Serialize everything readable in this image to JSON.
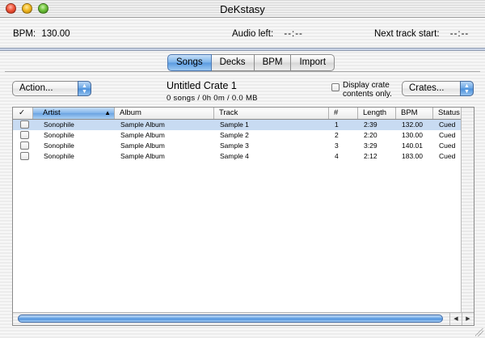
{
  "window": {
    "title": "DeKstasy"
  },
  "status": {
    "bpm_label": "BPM:",
    "bpm_value": "130.00",
    "audio_left_label": "Audio left:",
    "audio_left_value": "--:--",
    "next_track_label": "Next track start:",
    "next_track_value": "--:--"
  },
  "tabs": [
    {
      "label": "Songs",
      "selected": true
    },
    {
      "label": "Decks",
      "selected": false
    },
    {
      "label": "BPM",
      "selected": false
    },
    {
      "label": "Import",
      "selected": false
    }
  ],
  "toolbar": {
    "action_popup": "Action...",
    "crates_popup": "Crates..."
  },
  "crate": {
    "name": "Untitled Crate 1",
    "info": "0 songs / 0h 0m / 0.0 MB",
    "display_checkbox_label": "Display crate contents only.",
    "display_checked": false
  },
  "table": {
    "columns": [
      "✓",
      "Artist",
      "Album",
      "Track",
      "#",
      "Length",
      "BPM",
      "Status"
    ],
    "sorted_column": "Artist",
    "rows": [
      {
        "checked": false,
        "artist": "Sonophile",
        "album": "Sample Album",
        "track": "Sample 1",
        "num": "1",
        "length": "2:39",
        "bpm": "132.00",
        "status": "Cued",
        "selected": true
      },
      {
        "checked": false,
        "artist": "Sonophile",
        "album": "Sample Album",
        "track": "Sample 2",
        "num": "2",
        "length": "2:20",
        "bpm": "130.00",
        "status": "Cued",
        "selected": false
      },
      {
        "checked": false,
        "artist": "Sonophile",
        "album": "Sample Album",
        "track": "Sample 3",
        "num": "3",
        "length": "3:29",
        "bpm": "140.01",
        "status": "Cued",
        "selected": false
      },
      {
        "checked": false,
        "artist": "Sonophile",
        "album": "Sample Album",
        "track": "Sample 4",
        "num": "4",
        "length": "2:12",
        "bpm": "183.00",
        "status": "Cued",
        "selected": false
      }
    ]
  },
  "icons": {
    "close": "close-button-icon",
    "minimize": "minimize-button-icon",
    "zoom": "zoom-button-icon",
    "popup_arrows": "up-down-arrows-icon",
    "sort": "sort-ascending-icon"
  },
  "colors": {
    "accent": "#5a9be0",
    "selection": "#c8dbf2"
  }
}
